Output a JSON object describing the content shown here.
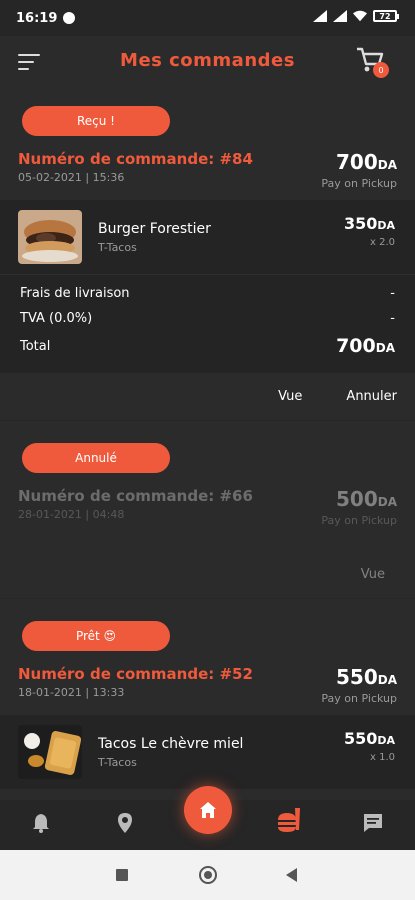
{
  "statusbar": {
    "time": "16:19",
    "battery": "72"
  },
  "header": {
    "title": "Mes commandes",
    "cart_count": "0"
  },
  "orders": [
    {
      "status": "Reçu !",
      "number": "Numéro de commande: #84",
      "date": "05-02-2021 | 15:36",
      "total": "700",
      "currency": "DA",
      "payment": "Pay on Pickup",
      "item": {
        "name": "Burger Forestier",
        "vendor": "T-Tacos",
        "price": "350",
        "currency": "DA",
        "qty": "x 2.0"
      },
      "summary": {
        "delivery_label": "Frais de livraison",
        "delivery_value": "-",
        "tva_label": "TVA (0.0%)",
        "tva_value": "-",
        "total_label": "Total",
        "total_value": "700",
        "total_currency": "DA"
      },
      "actions": {
        "view": "Vue",
        "cancel": "Annuler"
      }
    },
    {
      "status": "Annulé",
      "number": "Numéro de commande: #66",
      "date": "28-01-2021 | 04:48",
      "total": "500",
      "currency": "DA",
      "payment": "Pay on Pickup",
      "actions": {
        "view": "Vue"
      }
    },
    {
      "status": "Prêt 😍",
      "number": "Numéro de commande: #52",
      "date": "18-01-2021 | 13:33",
      "total": "550",
      "currency": "DA",
      "payment": "Pay on Pickup",
      "item": {
        "name": "Tacos Le chèvre miel",
        "vendor": "T-Tacos",
        "price": "550",
        "currency": "DA",
        "qty": "x 1.0"
      }
    }
  ],
  "bottom_nav": [
    "bell-icon",
    "location-pin-icon",
    "home-icon",
    "food-icon",
    "chat-icon"
  ],
  "colors": {
    "accent": "#f05a3c",
    "background": "#2b2b2b",
    "card": "#242424"
  }
}
